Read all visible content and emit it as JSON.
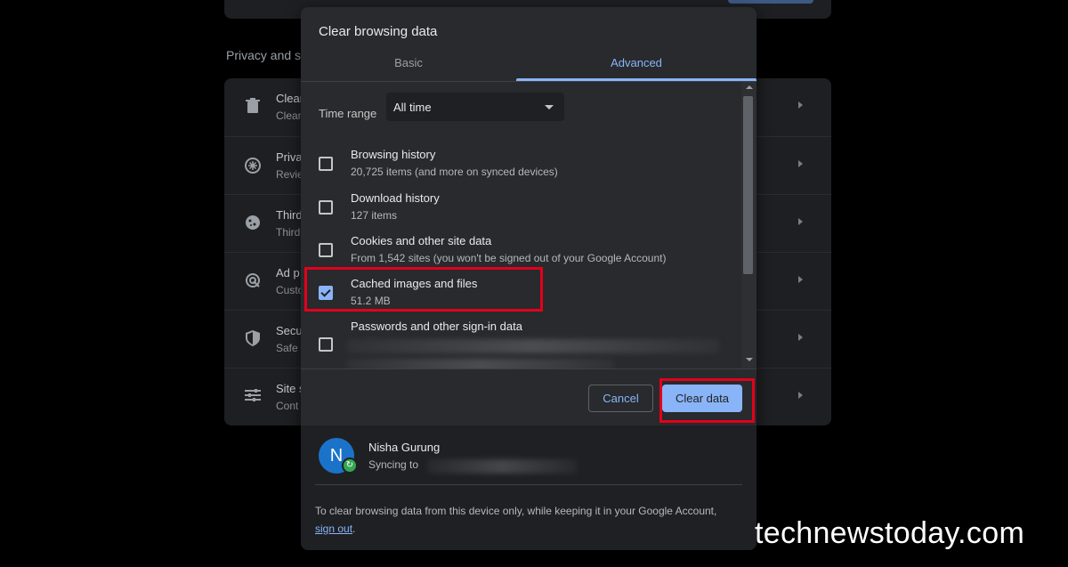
{
  "background_page": {
    "section_title": "Privacy and s",
    "rows": [
      {
        "icon": "trash-icon",
        "title": "Clear",
        "subtitle": "Clear"
      },
      {
        "icon": "privacy-guide-icon",
        "title": "Priva",
        "subtitle": "Revie"
      },
      {
        "icon": "cookie-icon",
        "title": "Third",
        "subtitle": "Third"
      },
      {
        "icon": "ad-privacy-icon",
        "title": "Ad p",
        "subtitle": "Custo"
      },
      {
        "icon": "shield-icon",
        "title": "Secu",
        "subtitle": "Safe"
      },
      {
        "icon": "tune-icon",
        "title": "Site s",
        "subtitle": "Cont"
      }
    ]
  },
  "dialog": {
    "title": "Clear browsing data",
    "tabs": [
      {
        "label": "Basic",
        "selected": false
      },
      {
        "label": "Advanced",
        "selected": true
      }
    ],
    "time_range": {
      "label": "Time range",
      "value": "All time"
    },
    "items": [
      {
        "title": "Browsing history",
        "subtitle": "20,725 items (and more on synced devices)",
        "checked": false
      },
      {
        "title": "Download history",
        "subtitle": "127 items",
        "checked": false
      },
      {
        "title": "Cookies and other site data",
        "subtitle": "From 1,542 sites (you won't be signed out of your Google Account)",
        "checked": false
      },
      {
        "title": "Cached images and files",
        "subtitle": "51.2 MB",
        "checked": true
      },
      {
        "title": "Passwords and other sign-in data",
        "subtitle": "",
        "checked": false
      }
    ],
    "buttons": {
      "cancel": "Cancel",
      "clear": "Clear data"
    },
    "account": {
      "avatar_letter": "N",
      "name": "Nisha Gurung",
      "sync_prefix": "Syncing to",
      "note": "To clear browsing data from this device only, while keeping it in your Google Account,",
      "sign_out": "sign out",
      "note_end": "."
    }
  },
  "colors": {
    "accent": "#8ab4f8",
    "dialog_bg": "#282a2d",
    "highlight": "#e3001b",
    "avatar": "#1a73c8",
    "sync_badge": "#34a853"
  },
  "watermark": "technewstoday.com"
}
